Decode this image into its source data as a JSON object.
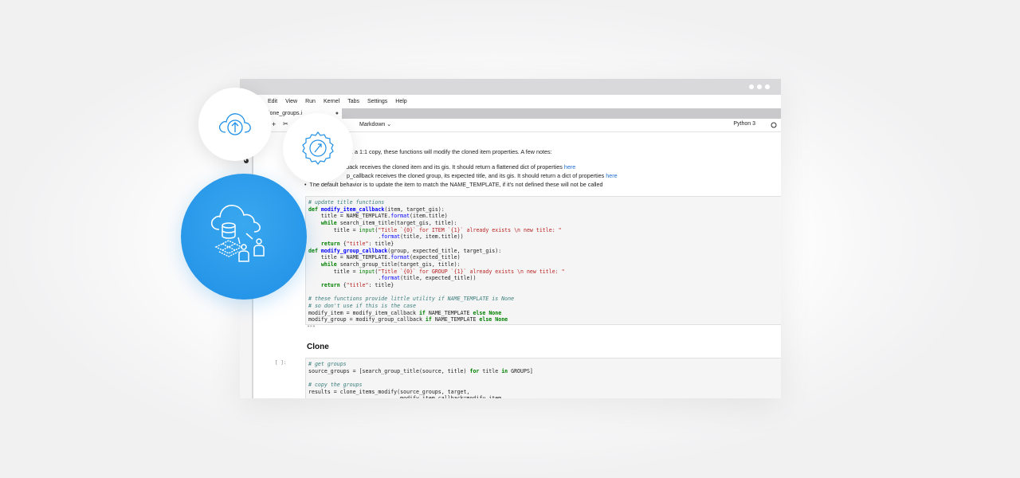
{
  "menu": {
    "items": [
      "Edit",
      "View",
      "Run",
      "Kernel",
      "Tabs",
      "Settings",
      "Help"
    ]
  },
  "tab": {
    "label": "lone_groups.i",
    "close": "●"
  },
  "toolbar": {
    "cell_type": "Markdown",
    "kernel": "Python 3"
  },
  "notebook": {
    "intro": "nt a 1:1 copy, these functions will modify the cloned item properties. A few notes:",
    "bullet1_pre": "allback receives the cloned item and its gis. It should return a flattened dict of properties",
    "bullet1_link": "here",
    "bullet2_pre": "p_callback receives the cloned group, its expected title, and its gis. It should return a dict of properties",
    "bullet2_link": "here",
    "bullet3": "he default behavior is to update the item to match the NAME_TEMPLATE, if it's not defined these will not be called",
    "heading_clone": "Clone",
    "prompt_clone": "[ ]:",
    "ellipsis": "\"\"\""
  },
  "colors": {
    "accent_blue": "#1f8fe6",
    "link": "#1f6fd1",
    "code_bg": "#f5f5f5",
    "keyword": "#008000",
    "string": "#ba2121",
    "comment": "#3a7d7c"
  },
  "icons": [
    "cloud-upload-icon",
    "gear-sync-icon",
    "cloud-database-icon",
    "folder-icon",
    "wrench-icon",
    "paintbrush-icon"
  ]
}
